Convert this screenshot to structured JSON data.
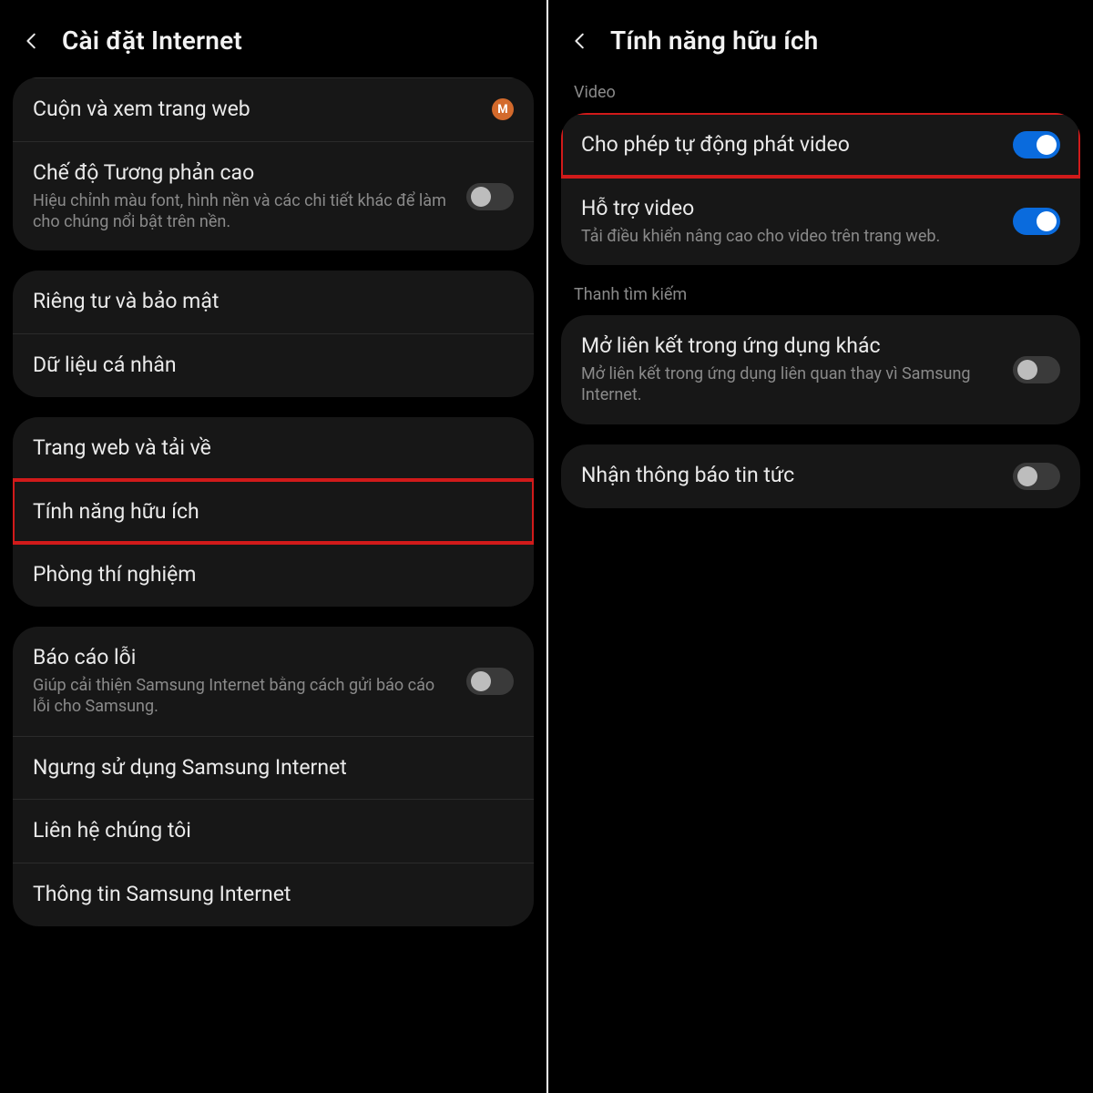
{
  "colors": {
    "accent": "#0a6bdd",
    "highlight": "#d11a1a",
    "badge": "#d36a2c"
  },
  "left": {
    "title": "Cài đặt Internet",
    "groups": [
      {
        "rows": [
          {
            "title": "Cuộn và xem trang web",
            "badge": "M"
          },
          {
            "title": "Chế độ Tương phản cao",
            "sub": "Hiệu chỉnh màu font, hình nền và các chi tiết khác để làm cho chúng nổi bật trên nền.",
            "toggle": "off"
          }
        ]
      },
      {
        "rows": [
          {
            "title": "Riêng tư và bảo mật"
          },
          {
            "title": "Dữ liệu cá nhân"
          }
        ]
      },
      {
        "rows": [
          {
            "title": "Trang web và tải về"
          },
          {
            "title": "Tính năng hữu ích",
            "highlight": true
          },
          {
            "title": "Phòng thí nghiệm"
          }
        ]
      },
      {
        "rows": [
          {
            "title": "Báo cáo lỗi",
            "sub": "Giúp cải thiện Samsung Internet bằng cách gửi báo cáo lỗi cho Samsung.",
            "toggle": "off"
          },
          {
            "title": "Ngưng sử dụng Samsung Internet"
          },
          {
            "title": "Liên hệ chúng tôi"
          },
          {
            "title": "Thông tin Samsung Internet"
          }
        ]
      }
    ]
  },
  "right": {
    "title": "Tính năng hữu ích",
    "sections": [
      {
        "label": "Video",
        "rows": [
          {
            "title": "Cho phép tự động phát video",
            "toggle": "on",
            "highlight": true
          },
          {
            "title": "Hỗ trợ video",
            "sub": "Tải điều khiển nâng cao cho video trên trang web.",
            "toggle": "on"
          }
        ]
      },
      {
        "label": "Thanh tìm kiếm",
        "rows": [
          {
            "title": "Mở liên kết trong ứng dụng khác",
            "sub": "Mở liên kết trong ứng dụng liên quan thay vì Samsung Internet.",
            "toggle": "off"
          }
        ]
      },
      {
        "rows": [
          {
            "title": "Nhận thông báo tin tức",
            "toggle": "off"
          }
        ]
      }
    ]
  }
}
